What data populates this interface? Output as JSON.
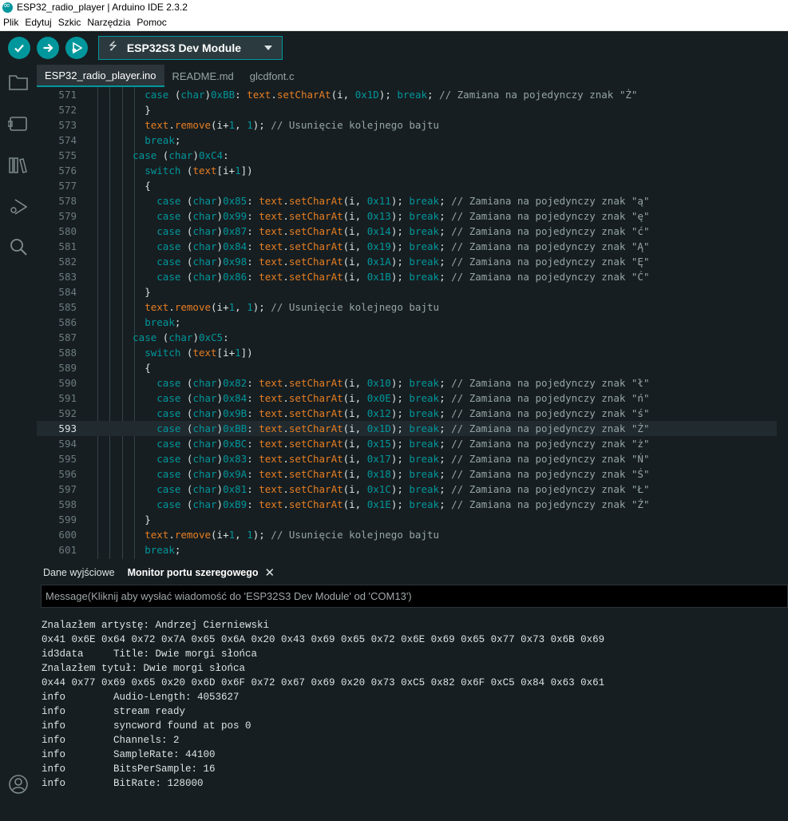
{
  "window": {
    "title": "ESP32_radio_player | Arduino IDE 2.3.2"
  },
  "menu": [
    "Plik",
    "Edytuj",
    "Szkic",
    "Narzędzia",
    "Pomoc"
  ],
  "toolbar": {
    "board": "ESP32S3 Dev Module"
  },
  "tabs": [
    "ESP32_radio_player.ino",
    "README.md",
    "glcdfont.c"
  ],
  "editor": {
    "current_line": 593,
    "lines": [
      {
        "n": "571",
        "code": "        case (char)0xBB: text.setCharAt(i, 0x1D); break; // Zamiana na pojedynczy znak \"Ż\""
      },
      {
        "n": "572",
        "code": "        }"
      },
      {
        "n": "573",
        "code": "        text.remove(i+1, 1); // Usunięcie kolejnego bajtu"
      },
      {
        "n": "574",
        "code": "        break;"
      },
      {
        "n": "575",
        "code": "      case (char)0xC4:"
      },
      {
        "n": "576",
        "code": "        switch (text[i+1])"
      },
      {
        "n": "577",
        "code": "        {"
      },
      {
        "n": "578",
        "code": "          case (char)0x85: text.setCharAt(i, 0x11); break; // Zamiana na pojedynczy znak \"ą\""
      },
      {
        "n": "579",
        "code": "          case (char)0x99: text.setCharAt(i, 0x13); break; // Zamiana na pojedynczy znak \"ę\""
      },
      {
        "n": "580",
        "code": "          case (char)0x87: text.setCharAt(i, 0x14); break; // Zamiana na pojedynczy znak \"ć\""
      },
      {
        "n": "581",
        "code": "          case (char)0x84: text.setCharAt(i, 0x19); break; // Zamiana na pojedynczy znak \"Ą\""
      },
      {
        "n": "582",
        "code": "          case (char)0x98: text.setCharAt(i, 0x1A); break; // Zamiana na pojedynczy znak \"Ę\""
      },
      {
        "n": "583",
        "code": "          case (char)0x86: text.setCharAt(i, 0x1B); break; // Zamiana na pojedynczy znak \"Ć\""
      },
      {
        "n": "584",
        "code": "        }"
      },
      {
        "n": "585",
        "code": "        text.remove(i+1, 1); // Usunięcie kolejnego bajtu"
      },
      {
        "n": "586",
        "code": "        break;"
      },
      {
        "n": "587",
        "code": "      case (char)0xC5:"
      },
      {
        "n": "588",
        "code": "        switch (text[i+1])"
      },
      {
        "n": "589",
        "code": "        {"
      },
      {
        "n": "590",
        "code": "          case (char)0x82: text.setCharAt(i, 0x10); break; // Zamiana na pojedynczy znak \"ł\""
      },
      {
        "n": "591",
        "code": "          case (char)0x84: text.setCharAt(i, 0x0E); break; // Zamiana na pojedynczy znak \"ń\""
      },
      {
        "n": "592",
        "code": "          case (char)0x9B: text.setCharAt(i, 0x12); break; // Zamiana na pojedynczy znak \"ś\""
      },
      {
        "n": "593",
        "code": "          case (char)0xBB: text.setCharAt(i, 0x1D); break; // Zamiana na pojedynczy znak \"Ż\""
      },
      {
        "n": "594",
        "code": "          case (char)0xBC: text.setCharAt(i, 0x15); break; // Zamiana na pojedynczy znak \"ż\""
      },
      {
        "n": "595",
        "code": "          case (char)0x83: text.setCharAt(i, 0x17); break; // Zamiana na pojedynczy znak \"Ń\""
      },
      {
        "n": "596",
        "code": "          case (char)0x9A: text.setCharAt(i, 0x18); break; // Zamiana na pojedynczy znak \"Ś\""
      },
      {
        "n": "597",
        "code": "          case (char)0x81: text.setCharAt(i, 0x1C); break; // Zamiana na pojedynczy znak \"Ł\""
      },
      {
        "n": "598",
        "code": "          case (char)0xB9: text.setCharAt(i, 0x1E); break; // Zamiana na pojedynczy znak \"Ź\""
      },
      {
        "n": "599",
        "code": "        }"
      },
      {
        "n": "600",
        "code": "        text.remove(i+1, 1); // Usunięcie kolejnego bajtu"
      },
      {
        "n": "601",
        "code": "        break;"
      }
    ]
  },
  "panel": {
    "tabs": [
      "Dane wyjściowe",
      "Monitor portu szeregowego"
    ],
    "message_placeholder": "Message(Kliknij aby wysłać wiadomość do 'ESP32S3 Dev Module' od 'COM13')",
    "output": [
      "Znalazłem artystę: Andrzej Cierniewski",
      "0x41 0x6E 0x64 0x72 0x7A 0x65 0x6A 0x20 0x43 0x69 0x65 0x72 0x6E 0x69 0x65 0x77 0x73 0x6B 0x69",
      "id3data     Title: Dwie morgi słońca",
      "Znalazłem tytuł: Dwie morgi słońca",
      "0x44 0x77 0x69 0x65 0x20 0x6D 0x6F 0x72 0x67 0x69 0x20 0x73 0xC5 0x82 0x6F 0xC5 0x84 0x63 0x61",
      "info        Audio-Length: 4053627",
      "info        stream ready",
      "info        syncword found at pos 0",
      "info        Channels: 2",
      "info        SampleRate: 44100",
      "info        BitsPerSample: 16",
      "info        BitRate: 128000"
    ]
  },
  "colors": {
    "accent": "#00979c",
    "background": "#171e21",
    "function": "#e67e22",
    "comment": "#95a5a6"
  }
}
